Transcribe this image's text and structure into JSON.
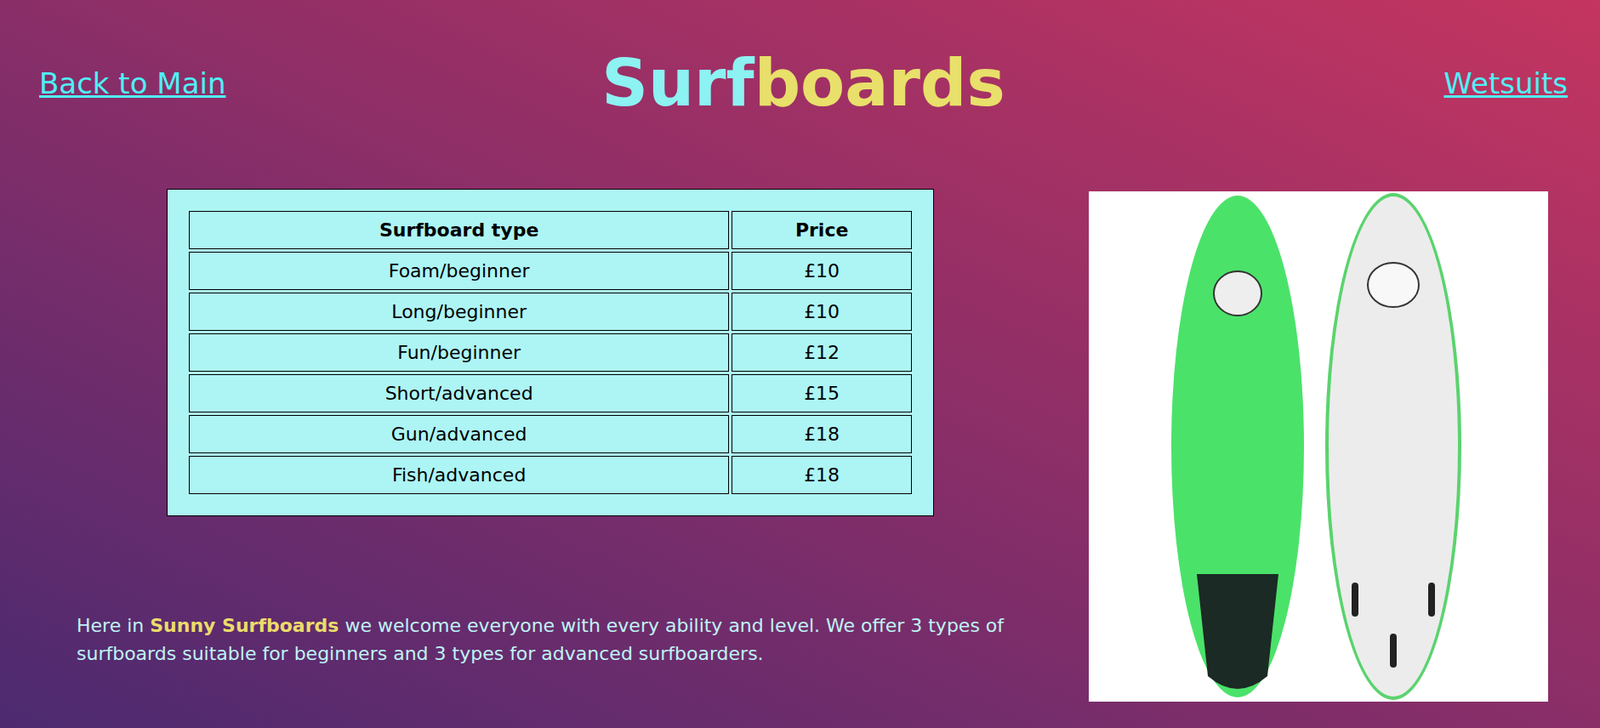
{
  "nav": {
    "back_link": "Back to Main",
    "next_link": "Wetsuits"
  },
  "title": {
    "part1": "Surf",
    "part2": "boards"
  },
  "table": {
    "columns": [
      "Surfboard type",
      "Price"
    ],
    "rows": [
      [
        "Foam/beginner",
        "£10"
      ],
      [
        "Long/beginner",
        "£10"
      ],
      [
        "Fun/beginner",
        "£12"
      ],
      [
        "Short/advanced",
        "£15"
      ],
      [
        "Gun/advanced",
        "£18"
      ],
      [
        "Fish/advanced",
        "£18"
      ]
    ]
  },
  "intro": {
    "before": "Here in ",
    "brand": "Sunny Surfboards",
    "after": " we welcome everyone with every ability and level. We offer 3 types of surfboards suitable for beginners and 3 types for advanced surfboarders."
  }
}
